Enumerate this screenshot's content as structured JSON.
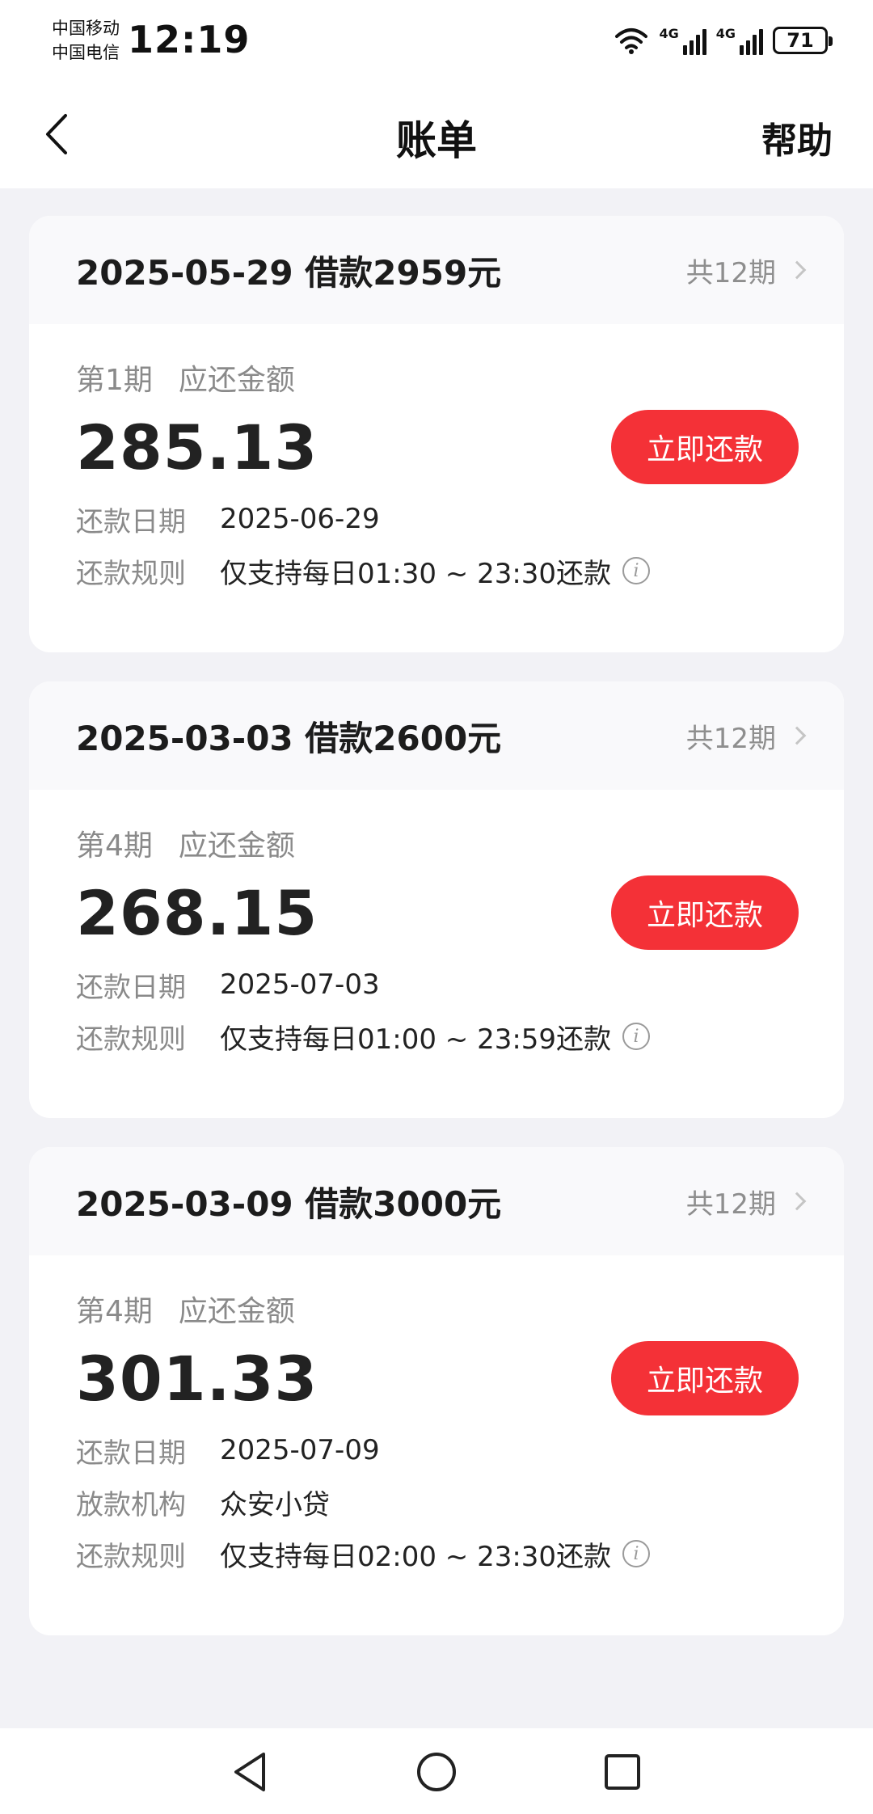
{
  "status_bar": {
    "carrier_1": "中国移动",
    "carrier_2": "中国电信",
    "time": "12:19",
    "network_1": "4G",
    "network_2": "4G",
    "battery": "71"
  },
  "nav": {
    "title": "账单",
    "help": "帮助"
  },
  "bills": [
    {
      "title": "2025-05-29 借款2959元",
      "terms": "共12期",
      "period": "第1期",
      "due_label": "应还金额",
      "amount": "285.13",
      "pay_label": "立即还款",
      "date_label": "还款日期",
      "date": "2025-06-29",
      "rule_label": "还款规则",
      "rule": "仅支持每日01:30 ~ 23:30还款"
    },
    {
      "title": "2025-03-03 借款2600元",
      "terms": "共12期",
      "period": "第4期",
      "due_label": "应还金额",
      "amount": "268.15",
      "pay_label": "立即还款",
      "date_label": "还款日期",
      "date": "2025-07-03",
      "rule_label": "还款规则",
      "rule": "仅支持每日01:00 ~ 23:59还款"
    },
    {
      "title": "2025-03-09 借款3000元",
      "terms": "共12期",
      "period": "第4期",
      "due_label": "应还金额",
      "amount": "301.33",
      "pay_label": "立即还款",
      "date_label": "还款日期",
      "date": "2025-07-09",
      "lender_label": "放款机构",
      "lender": "众安小贷",
      "rule_label": "还款规则",
      "rule": "仅支持每日02:00 ~ 23:30还款"
    }
  ],
  "colors": {
    "accent": "#f43137",
    "background": "#f2f2f6",
    "card_header": "#f9f9fb"
  },
  "icons": {
    "back": "chevron-left-icon",
    "more": "chevron-right-icon",
    "info": "info-icon",
    "sys_back": "triangle-back-icon",
    "sys_home": "circle-home-icon",
    "sys_recent": "square-recent-icon"
  }
}
